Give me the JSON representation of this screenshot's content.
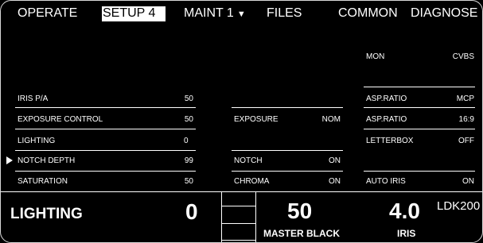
{
  "menu": {
    "operate": "OPERATE",
    "setup": "SETUP 4",
    "maint": "MAINT 1",
    "files": "FILES",
    "common": "COMMON",
    "diagnose": "DIAGNOSE"
  },
  "left_params": [
    {
      "label": "IRIS P/A",
      "value": "50"
    },
    {
      "label": "EXPOSURE CONTROL",
      "value": "50"
    },
    {
      "label": "LIGHTING",
      "value": "0"
    },
    {
      "label": "NOTCH DEPTH",
      "value": "99"
    },
    {
      "label": "SATURATION",
      "value": "50"
    }
  ],
  "mid_params": [
    {
      "label": "EXPOSURE",
      "value": "NOM"
    },
    {
      "label": "NOTCH",
      "value": "ON"
    },
    {
      "label": "CHROMA",
      "value": "ON"
    }
  ],
  "right_params": [
    {
      "label": "MON",
      "value": "CVBS"
    },
    {
      "label": "ASP.RATIO",
      "value": "MCP"
    },
    {
      "label": "ASP.RATIO",
      "value": "16:9"
    },
    {
      "label": "LETTERBOX",
      "value": "OFF"
    },
    {
      "label": "AUTO IRIS",
      "value": "ON"
    }
  ],
  "bottom": {
    "lighting_label": "LIGHTING",
    "lighting_value": "0",
    "master_black_value": "50",
    "master_black_label": "MASTER BLACK",
    "iris_value": "4.0",
    "iris_label": "IRIS",
    "camera_model": "LDK200"
  }
}
